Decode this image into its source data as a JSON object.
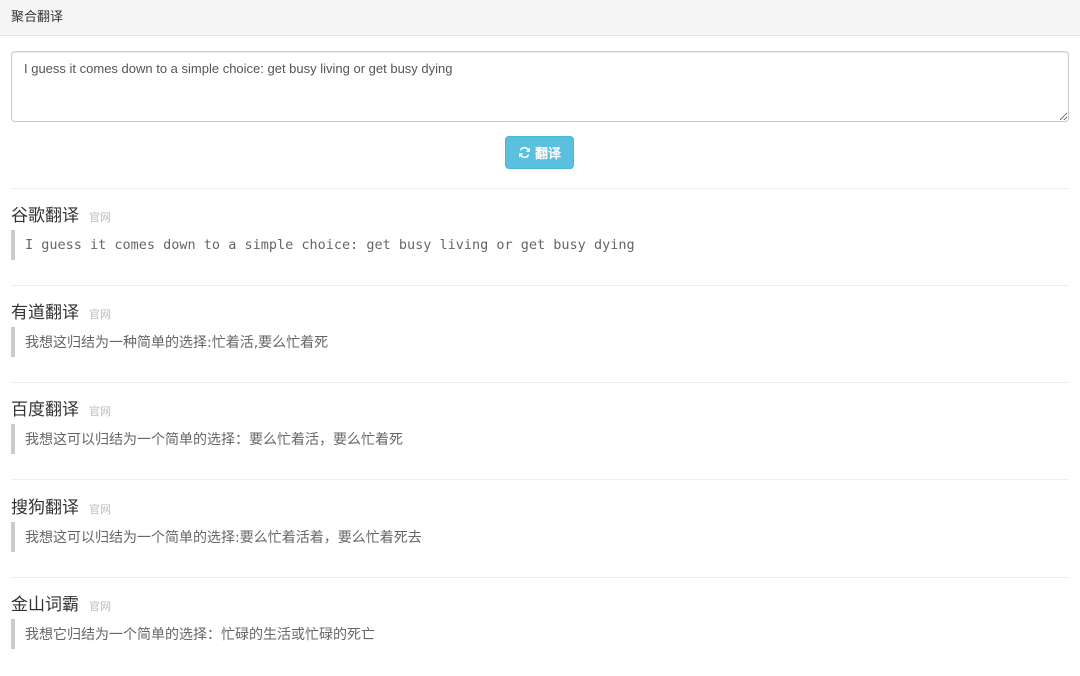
{
  "header": {
    "title": "聚合翻译"
  },
  "input": {
    "value": "I guess it comes down to a simple choice: get busy living or get busy dying"
  },
  "translate_button": {
    "label": "翻译",
    "icon": "refresh-icon",
    "color": "#5bc0de"
  },
  "results": [
    {
      "engine": "谷歌翻译",
      "link": "官网",
      "text": "I guess it comes down to a simple choice: get busy living or get busy dying"
    },
    {
      "engine": "有道翻译",
      "link": "官网",
      "text": "我想这归结为一种简单的选择:忙着活,要么忙着死"
    },
    {
      "engine": "百度翻译",
      "link": "官网",
      "text": "我想这可以归结为一个简单的选择：要么忙着活，要么忙着死"
    },
    {
      "engine": "搜狗翻译",
      "link": "官网",
      "text": "我想这可以归结为一个简单的选择:要么忙着活着，要么忙着死去"
    },
    {
      "engine": "金山词霸",
      "link": "官网",
      "text": "我想它归结为一个简单的选择：忙碌的生活或忙碌的死亡"
    }
  ]
}
